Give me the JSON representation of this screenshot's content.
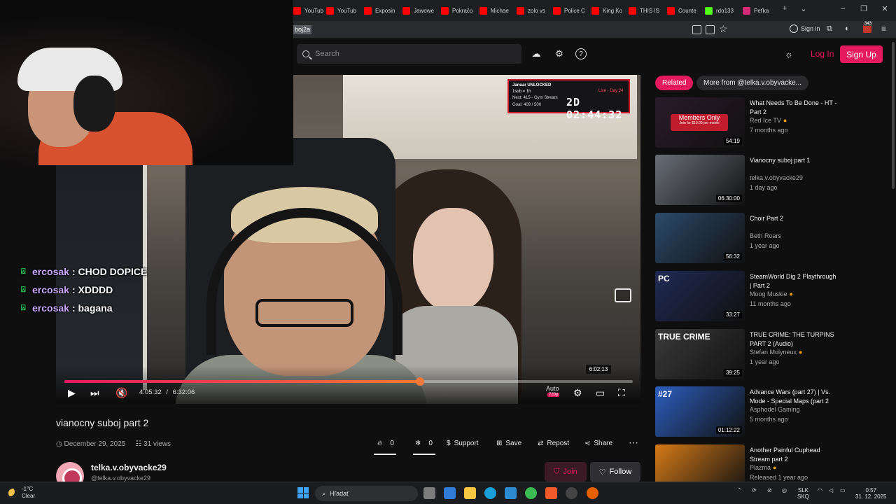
{
  "browser": {
    "tabs": [
      {
        "label": "YouTub",
        "color": "#ff0000"
      },
      {
        "label": "YouTub",
        "color": "#ff0000"
      },
      {
        "label": "Exposin",
        "color": "#ff0000"
      },
      {
        "label": "Jawowe",
        "color": "#ff0000"
      },
      {
        "label": "Pokračo",
        "color": "#ff0000"
      },
      {
        "label": "Michae",
        "color": "#ff0000"
      },
      {
        "label": "zolo vs",
        "color": "#ff0000"
      },
      {
        "label": "Police C",
        "color": "#ff0000"
      },
      {
        "label": "King Ko",
        "color": "#ff0000"
      },
      {
        "label": "THIS IS",
        "color": "#ff0000"
      },
      {
        "label": "Counte",
        "color": "#ff0000"
      },
      {
        "label": "rdo133",
        "color": "#53fc18"
      },
      {
        "label": "Peťka",
        "color": "#d62976"
      }
    ],
    "url_fragment": "boj2a",
    "sign_in": "Sign in",
    "ext_badge": "343"
  },
  "header": {
    "search_placeholder": "Search",
    "login": "Log In",
    "signup": "Sign Up"
  },
  "stream_overlay": {
    "line1": "Januar UNLOCKED",
    "line2": "1sub = 1h",
    "line3": "Next: 415 - Gym Stream",
    "line4": "Goal: 409 / 500",
    "live_day": "Live - Day 24",
    "timer": "2D 02:44:32"
  },
  "chat": [
    {
      "user": "ercosak",
      "message": ": CHOD DOPICE"
    },
    {
      "user": "ercosak",
      "message": ": XDDDD"
    },
    {
      "user": "ercosak",
      "message": ": bagana"
    }
  ],
  "player": {
    "current_time": "4:05:32",
    "separator": "/",
    "duration": "6:32:06",
    "hover_time": "6:02:13",
    "progress_fraction": 0.625,
    "quality_mode": "Auto",
    "quality": "720p"
  },
  "video": {
    "title": "vianocny suboj part 2",
    "date": "December 29, 2025",
    "views": "31 views",
    "likes": "0",
    "dislikes": "0",
    "support": "Support",
    "save": "Save",
    "repost": "Repost",
    "share": "Share"
  },
  "channel": {
    "name": "telka.v.obyvacke29",
    "handle": "@telka.v.obyvacke29",
    "join": "Join",
    "follow": "Follow"
  },
  "sidebar": {
    "tab_related": "Related",
    "tab_more": "More from @telka.v.obyvacke...",
    "items": [
      {
        "title": "What Needs To Be Done - HT - Part 2",
        "channel": "Red Ice TV",
        "verified": true,
        "age": "7 months ago",
        "duration": "54:19",
        "thumb": "#2a1a2a",
        "members_only": "Members Only",
        "join_text": "Join for $10.00 per month"
      },
      {
        "title": "Vianocny suboj part 1",
        "channel": "telka.v.obyvacke29",
        "verified": false,
        "age": "1 day ago",
        "duration": "06:30:00",
        "thumb": "#6a6e78"
      },
      {
        "title": "Choir Part 2",
        "channel": "Beth Roars",
        "verified": false,
        "age": "1 year ago",
        "duration": "56:32",
        "thumb": "#2b4a6a"
      },
      {
        "title": "SteamWorld Dig 2 Playthrough | Part 2",
        "channel": "Moog Muskie",
        "verified": true,
        "age": "11 months ago",
        "duration": "33:27",
        "thumb": "#1f2a55",
        "thumb_text": "PC"
      },
      {
        "title": "TRUE CRIME: THE TURPINS PART 2 (Audio)",
        "channel": "Stefan Molyneux",
        "verified": true,
        "age": "1 year ago",
        "duration": "39:25",
        "thumb": "#3a3a3a",
        "thumb_text": "TRUE CRIME"
      },
      {
        "title": "Advance Wars (part 27) | Vs. Mode - Special Maps (part 2",
        "channel": "Asphodel Gaming",
        "verified": false,
        "age": "5 months ago",
        "duration": "01:12:22",
        "thumb": "#2c5fbf",
        "thumb_text": "#27"
      },
      {
        "title": "Another Painful Cuphead Stream part 2",
        "channel": "Plazma",
        "verified": true,
        "age": "Released 1 year ago",
        "duration": "",
        "thumb": "#d57a18"
      }
    ]
  },
  "taskbar": {
    "temp": "-1°C",
    "weather": "Clear",
    "search": "Hľadať",
    "lang1": "SLK",
    "lang2": "SKQ",
    "time": "0:57",
    "date": "31. 12. 2025"
  }
}
